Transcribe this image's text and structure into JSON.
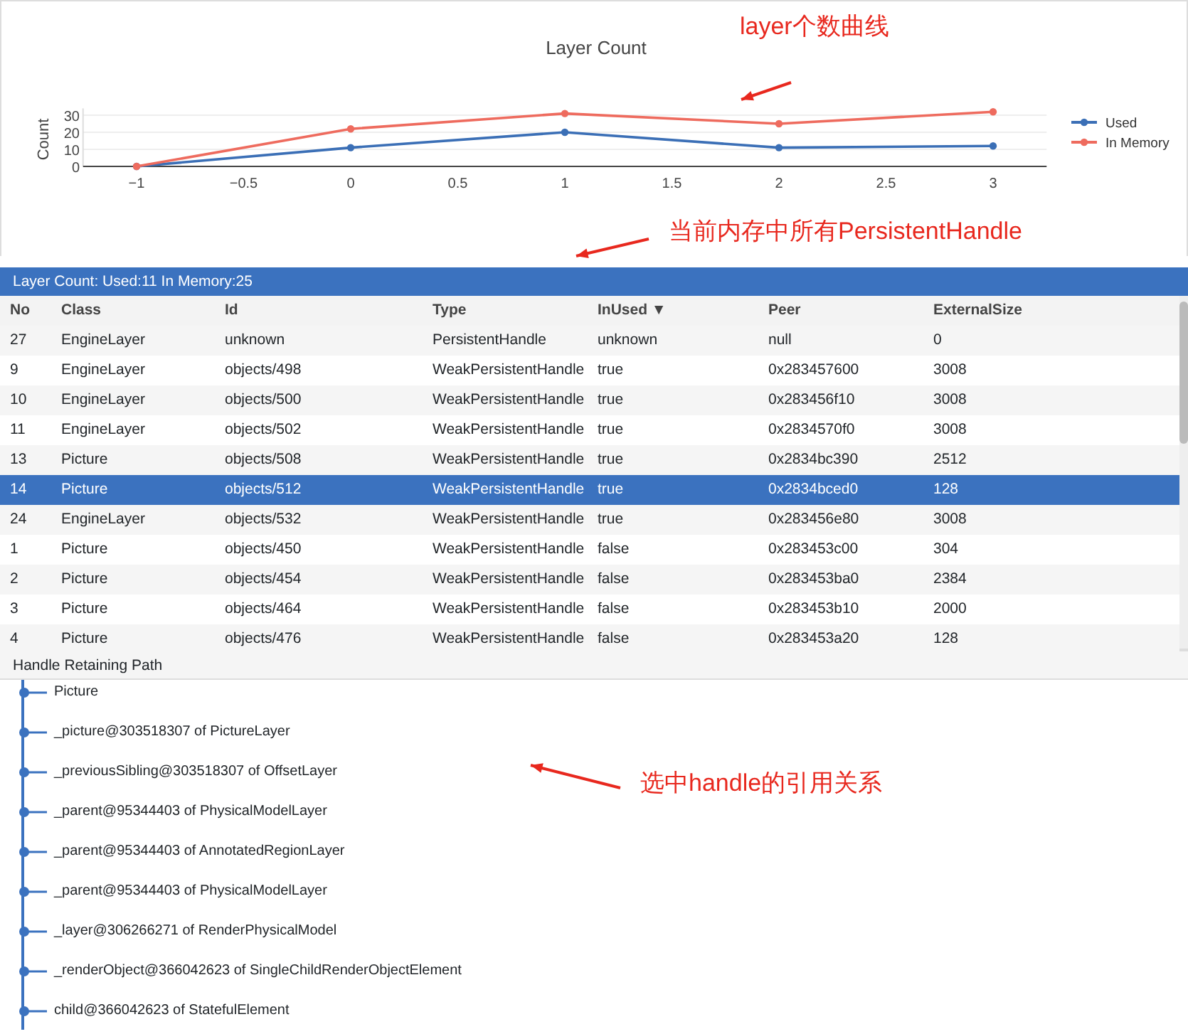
{
  "chart": {
    "chart_data": {
      "type": "line",
      "title": "Layer Count",
      "ylabel": "Count",
      "x": [
        -1,
        0,
        1,
        2,
        3
      ],
      "xlim": [
        -1.25,
        3.25
      ],
      "ylim": [
        0,
        34
      ],
      "grid": true,
      "legend": true,
      "xticks": [
        -1,
        -0.5,
        0,
        0.5,
        1,
        1.5,
        2,
        2.5,
        3
      ],
      "yticks": [
        0,
        10,
        20,
        30
      ],
      "series": [
        {
          "name": "Used",
          "color": "#3b6fb6",
          "marker": true,
          "values": [
            0,
            11,
            20,
            11,
            12
          ]
        },
        {
          "name": "In Memory",
          "color": "#ee6b5e",
          "marker": true,
          "values": [
            0,
            22,
            31,
            25,
            32
          ]
        }
      ]
    }
  },
  "annotations": [
    {
      "text": "layer个数曲线"
    },
    {
      "text": "当前内存中所有PersistentHandle"
    },
    {
      "text": "选中handle的引用关系"
    }
  ],
  "table": {
    "title": "Layer Count: Used:11 In Memory:25",
    "columns": [
      {
        "label": "No"
      },
      {
        "label": "Class"
      },
      {
        "label": "Id"
      },
      {
        "label": "Type"
      },
      {
        "label": "InUsed",
        "sort": "▼"
      },
      {
        "label": "Peer"
      },
      {
        "label": "ExternalSize"
      }
    ],
    "rows": [
      {
        "cells": [
          "27",
          "EngineLayer",
          "unknown",
          "PersistentHandle",
          "unknown",
          "null",
          "0"
        ],
        "selected": false
      },
      {
        "cells": [
          "9",
          "EngineLayer",
          "objects/498",
          "WeakPersistentHandle",
          "true",
          "0x283457600",
          "3008"
        ],
        "selected": false
      },
      {
        "cells": [
          "10",
          "EngineLayer",
          "objects/500",
          "WeakPersistentHandle",
          "true",
          "0x283456f10",
          "3008"
        ],
        "selected": false
      },
      {
        "cells": [
          "11",
          "EngineLayer",
          "objects/502",
          "WeakPersistentHandle",
          "true",
          "0x2834570f0",
          "3008"
        ],
        "selected": false
      },
      {
        "cells": [
          "13",
          "Picture",
          "objects/508",
          "WeakPersistentHandle",
          "true",
          "0x2834bc390",
          "2512"
        ],
        "selected": false
      },
      {
        "cells": [
          "14",
          "Picture",
          "objects/512",
          "WeakPersistentHandle",
          "true",
          "0x2834bced0",
          "128"
        ],
        "selected": true
      },
      {
        "cells": [
          "24",
          "EngineLayer",
          "objects/532",
          "WeakPersistentHandle",
          "true",
          "0x283456e80",
          "3008"
        ],
        "selected": false
      },
      {
        "cells": [
          "1",
          "Picture",
          "objects/450",
          "WeakPersistentHandle",
          "false",
          "0x283453c00",
          "304"
        ],
        "selected": false
      },
      {
        "cells": [
          "2",
          "Picture",
          "objects/454",
          "WeakPersistentHandle",
          "false",
          "0x283453ba0",
          "2384"
        ],
        "selected": false
      },
      {
        "cells": [
          "3",
          "Picture",
          "objects/464",
          "WeakPersistentHandle",
          "false",
          "0x283453b10",
          "2000"
        ],
        "selected": false
      },
      {
        "cells": [
          "4",
          "Picture",
          "objects/476",
          "WeakPersistentHandle",
          "false",
          "0x283453a20",
          "128"
        ],
        "selected": false
      }
    ]
  },
  "retaining_path": {
    "title": "Handle Retaining Path",
    "items": [
      "Picture",
      "_picture@303518307 of PictureLayer",
      "_previousSibling@303518307 of OffsetLayer",
      "_parent@95344403 of PhysicalModelLayer",
      "_parent@95344403 of AnnotatedRegionLayer",
      "_parent@95344403 of PhysicalModelLayer",
      "_layer@306266271 of RenderPhysicalModel",
      "_renderObject@366042623 of SingleChildRenderObjectElement",
      "child@366042623 of StatefulElement"
    ]
  }
}
